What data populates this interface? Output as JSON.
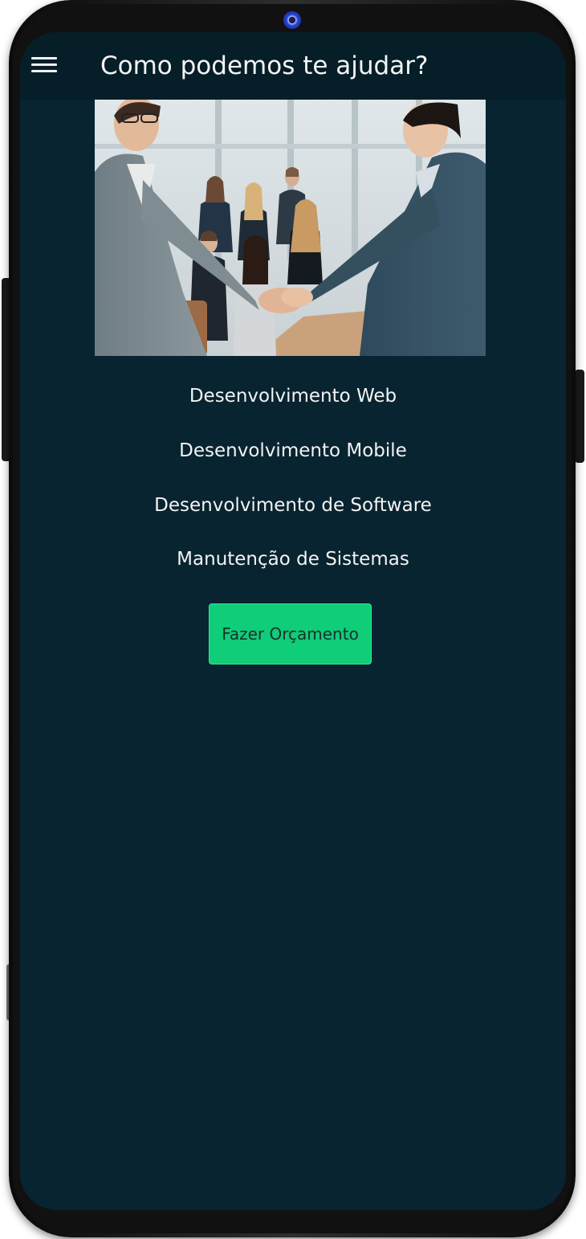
{
  "app_bar": {
    "title": "Como podemos te ajudar?",
    "menu_icon": "hamburger-menu-icon"
  },
  "hero_image": {
    "subject": "business-handshake-office-photo"
  },
  "services": [
    {
      "label": "Desenvolvimento Web"
    },
    {
      "label": "Desenvolvimento Mobile"
    },
    {
      "label": "Desenvolvimento de Software"
    },
    {
      "label": "Manutenção de Sistemas"
    }
  ],
  "cta": {
    "label": "Fazer Orçamento"
  },
  "colors": {
    "screen_background": "#082430",
    "app_bar_background": "#051e28",
    "cta_background": "#0fcd79",
    "text": "#f3f3f3"
  }
}
